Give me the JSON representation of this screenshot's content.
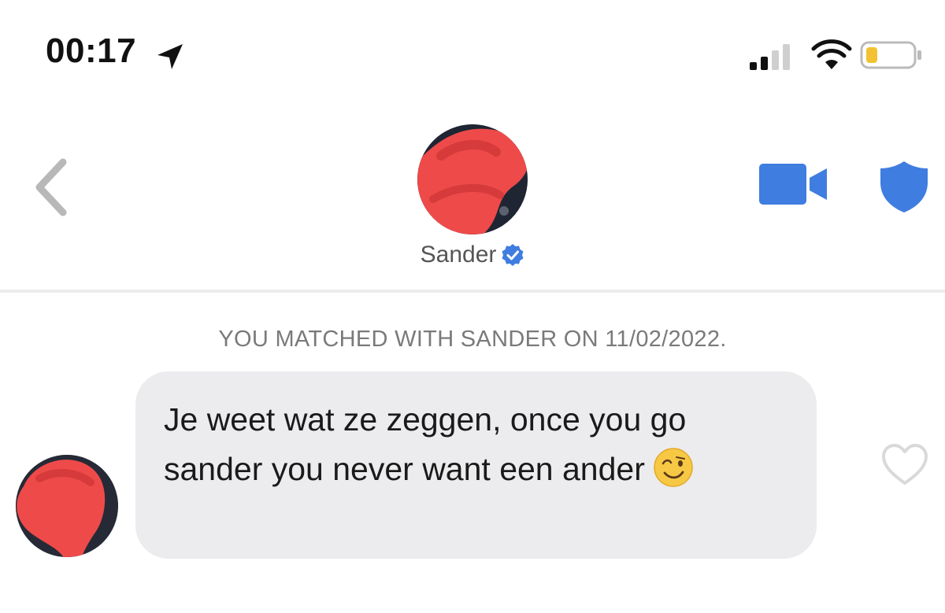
{
  "status_bar": {
    "time": "00:17",
    "icons": [
      "location-arrow-icon",
      "signal-bars-icon",
      "wifi-icon",
      "battery-low-icon"
    ]
  },
  "header": {
    "back_icon": "chevron-left-icon",
    "profile_name": "Sander",
    "verified_icon": "verified-badge-icon",
    "video_icon": "video-camera-icon",
    "safety_icon": "shield-icon"
  },
  "chat": {
    "match_notice": "YOU MATCHED WITH SANDER ON 11/02/2022.",
    "messages": [
      {
        "text": "Je weet wat ze zeggen, once you go sander you never want een ander",
        "emoji": "winking-face-emoji",
        "like_icon": "heart-outline-icon"
      }
    ]
  },
  "colors": {
    "accent_blue": "#3f7de0",
    "bubble_gray": "#ececee",
    "redaction_red": "#ee4a4a",
    "muted_text": "#7a7a7a"
  }
}
